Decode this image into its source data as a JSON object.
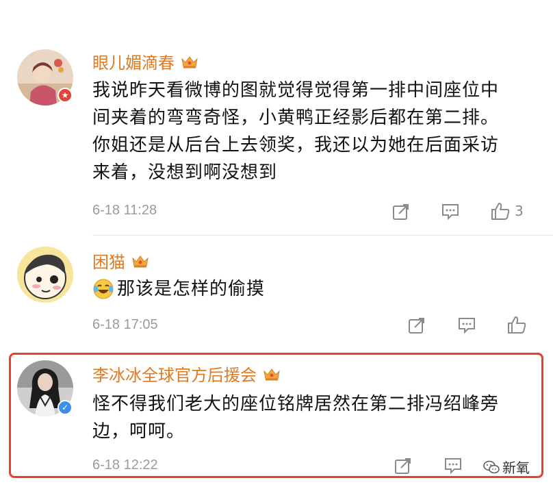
{
  "colors": {
    "username": "#e07a1f",
    "highlight_border": "#e8402a",
    "meta_gray": "#9a9a9a",
    "verified_blue": "#3d8ee8",
    "badge_red": "#e0453a"
  },
  "comments": [
    {
      "username": "眼儿媚滴春",
      "text_lines": [
        "我说昨天看微博的图就觉得觉得第一排中间座位中",
        "间夹着的弯弯奇怪，小黄鸭正经影后都在第二排。",
        "你姐还是从后台上去领奖，我还以为她在后面采访",
        "来着，没想到啊没想到"
      ],
      "timestamp": "6-18 11:28",
      "like_count": "3",
      "badge": "star-badge"
    },
    {
      "username": "困猫",
      "emoji": "laughing-crying-emoji",
      "text": "那该是怎样的偷摸",
      "timestamp": "6-18 17:05",
      "like_count": ""
    },
    {
      "username": "李冰冰全球官方后援会",
      "text_lines": [
        "怪不得我们老大的座位铭牌居然在第二排冯绍峰旁",
        "边，呵呵。"
      ],
      "timestamp": "6-18 12:22",
      "badge": "verified-badge",
      "highlighted": true
    }
  ],
  "watermark": {
    "label": "新氧",
    "icon": "wechat-icon"
  },
  "icons": {
    "repost": "repost-icon",
    "comment": "comment-icon",
    "like": "thumbs-up-icon",
    "member": "crown-icon"
  }
}
